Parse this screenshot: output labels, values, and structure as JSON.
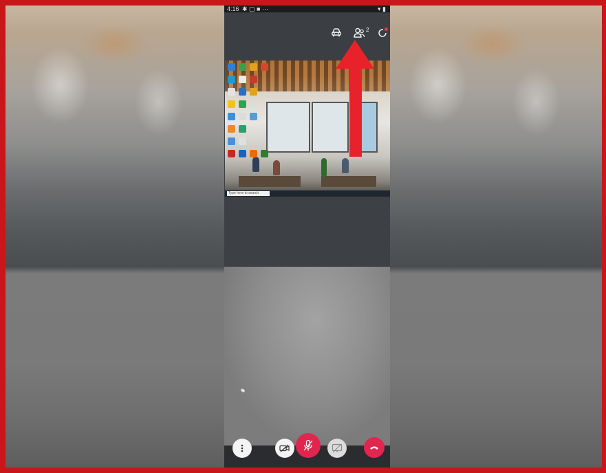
{
  "status_bar": {
    "time": "4:16",
    "left_icons": "✱ ▢ ■ ···",
    "right_icons": "▾ ▮"
  },
  "header": {
    "participants_count": "2",
    "icons": [
      "car-mode-icon",
      "participants-icon",
      "refresh-icon"
    ]
  },
  "shared_screen": {
    "taskbar_search_placeholder": "Type here to search"
  },
  "controls": {
    "buttons": [
      "more-options",
      "video-off",
      "mute-microphone",
      "share-screen",
      "end-call"
    ],
    "mute_color": "#e0264f",
    "end_call_color": "#e0264f"
  },
  "colors": {
    "frame_border": "#c8161b",
    "arrow": "#e8222a",
    "notification_dot": "#e53945"
  }
}
